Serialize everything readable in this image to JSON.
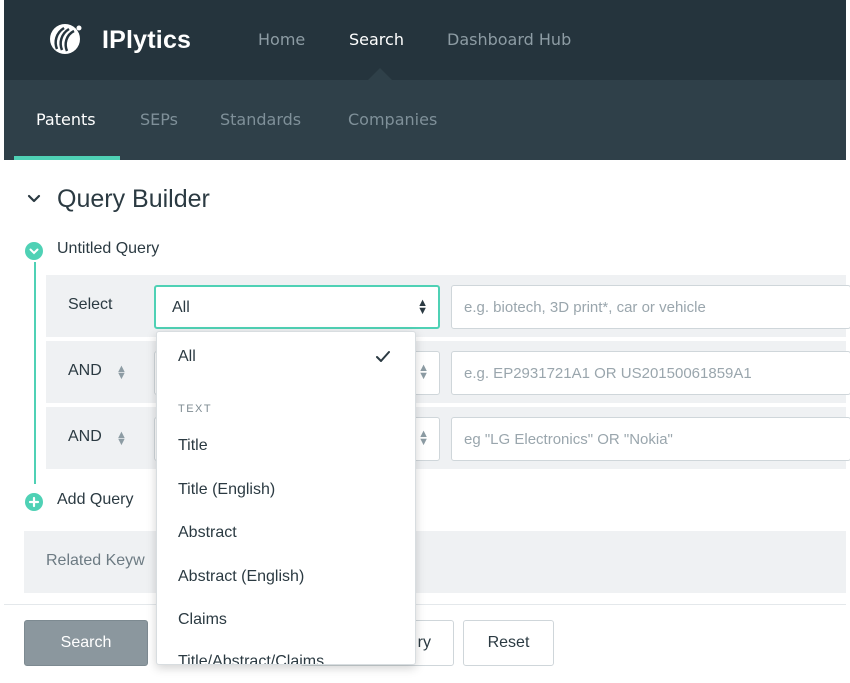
{
  "app": {
    "brand": "IPlytics",
    "icons": {
      "logo": "iplytics-logo-icon"
    }
  },
  "top_nav": {
    "items": [
      {
        "label": "Home",
        "active": false
      },
      {
        "label": "Search",
        "active": true
      },
      {
        "label": "Dashboard Hub",
        "active": false
      }
    ]
  },
  "sub_nav": {
    "items": [
      {
        "label": "Patents",
        "active": true
      },
      {
        "label": "SEPs",
        "active": false
      },
      {
        "label": "Standards",
        "active": false
      },
      {
        "label": "Companies",
        "active": false
      }
    ]
  },
  "query_builder": {
    "title": "Query Builder",
    "query_name": "Untitled Query",
    "rows": [
      {
        "operator": "Select",
        "field": "All",
        "placeholder": "e.g. biotech, 3D print*, car or vehicle"
      },
      {
        "operator": "AND",
        "field": "",
        "placeholder": "e.g. EP2931721A1 OR US20150061859A1"
      },
      {
        "operator": "AND",
        "field": "",
        "placeholder": "eg \"LG Electronics\" OR \"Nokia\""
      }
    ],
    "add_query_label": "Add Query",
    "related_keywords_label": "Related Keyw"
  },
  "dropdown": {
    "selected": "All",
    "items": [
      {
        "label": "All",
        "selected": true
      },
      {
        "group": "TEXT"
      },
      {
        "label": "Title"
      },
      {
        "label": "Title (English)"
      },
      {
        "label": "Abstract"
      },
      {
        "label": "Abstract (English)"
      },
      {
        "label": "Claims"
      },
      {
        "label": "Title/Abstract/Claims"
      }
    ]
  },
  "buttons": {
    "search": "Search",
    "query_partial": "ry",
    "reset": "Reset"
  },
  "colors": {
    "topbar": "#25343d",
    "subbar": "#2f4049",
    "accent": "#4fd1b5",
    "row_bg": "#eff1f3",
    "search_button": "#8b979e"
  }
}
